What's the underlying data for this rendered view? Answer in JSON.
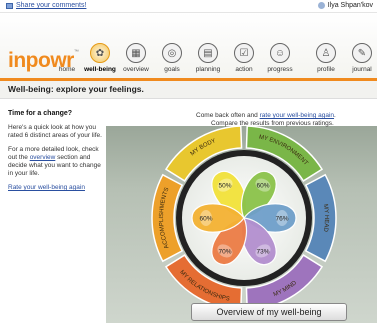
{
  "topbar": {
    "share_link": "Share your comments!",
    "user_name": "Ilya Shpan'kov"
  },
  "logo": {
    "text": "inpowr",
    "tm": "™"
  },
  "nav": [
    {
      "label": "home"
    },
    {
      "label": "well-being"
    },
    {
      "label": "overview"
    },
    {
      "label": "goals"
    },
    {
      "label": "planning"
    },
    {
      "label": "action"
    },
    {
      "label": "progress"
    },
    {
      "label": "profile"
    },
    {
      "label": "journal"
    }
  ],
  "page_title": "Well-being: explore your feelings.",
  "left": {
    "heading": "Time for a change?",
    "p1": "Here's a quick look at how you rated 6 distinct areas of your life.",
    "p2_pre": "For a more detailed look, check out the ",
    "p2_link": "overview",
    "p2_post": " section and decide what you want to change in your life.",
    "rate_link": "Rate your well-being again"
  },
  "panel": {
    "line1_pre": "Come back often and ",
    "line1_link": "rate your well-being again",
    "line1_post": ".",
    "line2": "Compare the results from previous ratings."
  },
  "wheel": {
    "segments": [
      {
        "label": "MY BODY",
        "value": "50%",
        "color": "#f2e23a"
      },
      {
        "label": "MY ENVIRONMENT",
        "value": "60%",
        "color": "#8bc34a"
      },
      {
        "label": "MY HEAD",
        "value": "76%",
        "color": "#6f9fca"
      },
      {
        "label": "MY MIND",
        "value": "73%",
        "color": "#b38fcf"
      },
      {
        "label": "MY RELATIONSHIPS",
        "value": "70%",
        "color": "#ec7c45"
      },
      {
        "label": "ACCOMPLISHMENTS",
        "value": "60%",
        "color": "#f4b233"
      }
    ],
    "ring_colors": {
      "body": "#e8c72f",
      "environment": "#7ab648",
      "head": "#5a88b8",
      "mind": "#9e74bd",
      "relationships": "#e56d33",
      "accomplishments": "#eda02a"
    }
  },
  "overview_button": "Overview of my well-being"
}
